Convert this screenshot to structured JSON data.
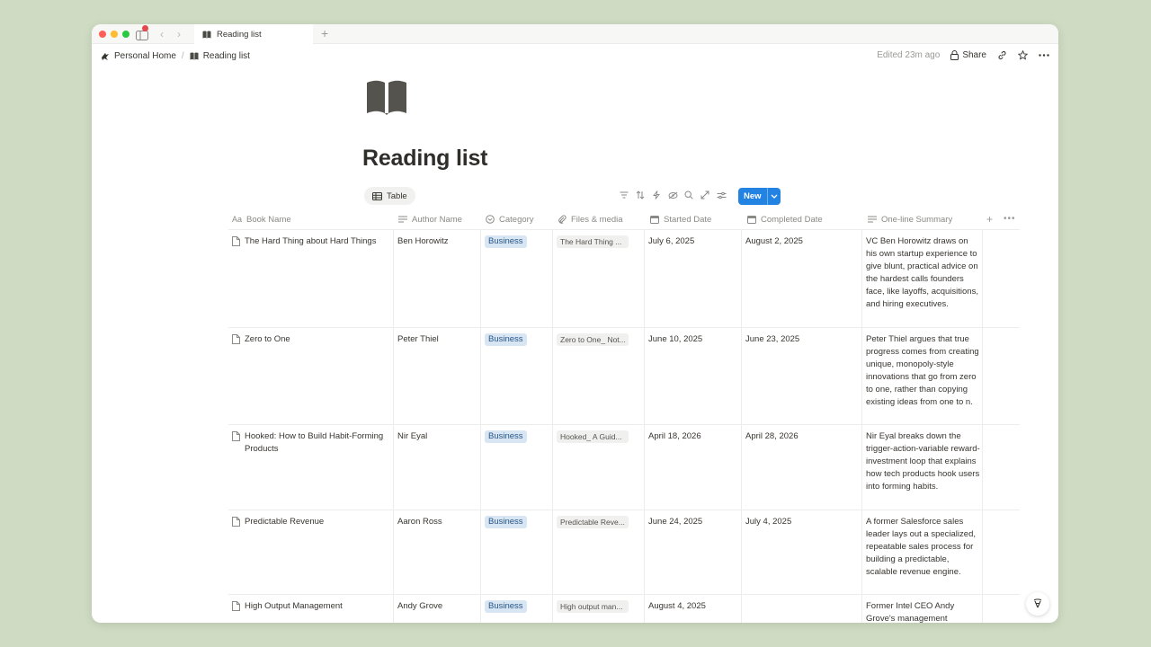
{
  "window": {
    "tab_title": "Reading list",
    "new_tab_icon": "plus-icon"
  },
  "breadcrumb": {
    "items": [
      {
        "label": "Personal Home",
        "icon": "home-icon"
      },
      {
        "label": "Reading list",
        "icon": "book-icon"
      }
    ]
  },
  "topbar": {
    "edited": "Edited 23m ago",
    "share_label": "Share"
  },
  "page": {
    "title": "Reading list",
    "icon": "open-book-icon"
  },
  "view": {
    "tab_label": "Table",
    "new_label": "New"
  },
  "table": {
    "columns": [
      {
        "label": "Book Name",
        "icon": "title-icon"
      },
      {
        "label": "Author Name",
        "icon": "text-icon"
      },
      {
        "label": "Category",
        "icon": "select-icon"
      },
      {
        "label": "Files & media",
        "icon": "paperclip-icon"
      },
      {
        "label": "Started Date",
        "icon": "calendar-icon"
      },
      {
        "label": "Completed Date",
        "icon": "calendar-icon"
      },
      {
        "label": "One-line Summary",
        "icon": "text-icon"
      }
    ],
    "rows": [
      {
        "name": "The Hard Thing about Hard Things",
        "author": "Ben Horowitz",
        "category": "Business",
        "file": "The Hard Thing ...",
        "started": "July 6, 2025",
        "completed": "August 2, 2025",
        "summary": "VC Ben Horowitz draws on his own startup experience to give blunt, practical advice on the hardest calls founders face, like layoffs, acquisitions, and hiring executives."
      },
      {
        "name": "Zero to One",
        "author": "Peter Thiel",
        "category": "Business",
        "file": "Zero to One_ Not...",
        "started": "June 10, 2025",
        "completed": "June 23, 2025",
        "summary": "Peter Thiel argues that true progress comes from creating unique, monopoly-style innovations that go from zero to one, rather than copying existing ideas from one to n."
      },
      {
        "name": "Hooked: How to Build Habit-Forming Products",
        "author": "Nir Eyal",
        "category": "Business",
        "file": "Hooked_ A Guid...",
        "started": "April 18, 2026",
        "completed": "April 28, 2026",
        "summary": "Nir Eyal breaks down the trigger-action-variable reward-investment loop that explains how tech products hook users into forming habits."
      },
      {
        "name": "Predictable Revenue",
        "author": "Aaron Ross",
        "category": "Business",
        "file": "Predictable Reve...",
        "started": "June 24, 2025",
        "completed": "July 4, 2025",
        "summary": "A former Salesforce sales leader lays out a specialized, repeatable sales process for building a predictable, scalable revenue engine."
      },
      {
        "name": "High Output Management",
        "author": "Andy Grove",
        "category": "Business",
        "file": "High output man...",
        "started": "August 4, 2025",
        "completed": "",
        "summary": "Former Intel CEO Andy Grove's management"
      }
    ]
  },
  "colors": {
    "accent": "#2383e2",
    "badge_bg": "#d8e5f2",
    "badge_text": "#27578a",
    "background": "#cfdcc3"
  }
}
